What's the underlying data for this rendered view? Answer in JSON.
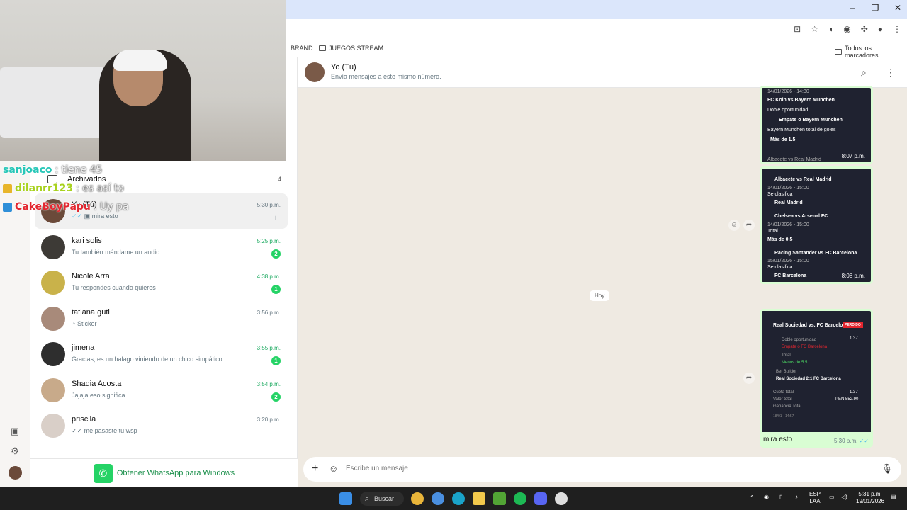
{
  "browser": {
    "bookmarks": [
      "BRAND",
      "JUEGOS STREAM"
    ],
    "all_bookmarks": "Todos los marcadores"
  },
  "chat_list": {
    "archived_label": "Archivados",
    "archived_count": "4",
    "chats": [
      {
        "name": "Yo (Tú)",
        "preview": "mira esto",
        "time": "5:30 p.m.",
        "unread": "",
        "pinned": true
      },
      {
        "name": "kari solis",
        "preview": "Tu también mándame un audio",
        "time": "5:25 p.m.",
        "unread": "2"
      },
      {
        "name": "Nicole Arra",
        "preview": "Tu respondes cuando quieres",
        "time": "4:38 p.m.",
        "unread": "1"
      },
      {
        "name": "tatiana guti",
        "preview": "Sticker",
        "time": "3:56 p.m.",
        "unread": ""
      },
      {
        "name": "jimena",
        "preview": "Gracias, es un halago viniendo de un chico simpático",
        "time": "3:55 p.m.",
        "unread": "1"
      },
      {
        "name": "Shadia Acosta",
        "preview": "Jajaja eso significa",
        "time": "3:54 p.m.",
        "unread": "2"
      },
      {
        "name": "priscila",
        "preview": "me pasaste tu wsp",
        "time": "3:20 p.m.",
        "unread": ""
      }
    ],
    "get_app_label": "Obtener WhatsApp para Windows"
  },
  "conversation": {
    "title": "Yo (Tú)",
    "subtitle": "Envía mensajes a este mismo número.",
    "day_label": "Hoy",
    "bet1": {
      "lines": [
        "14/01/2026 - 14:30",
        "FC Köln  vs  Bayern München",
        "Doble oportunidad",
        "Empate o Bayern München",
        "Bayern München total de goles",
        "Más de 1.5",
        "Albacete  vs  Real Madrid"
      ],
      "time": "8:07 p.m."
    },
    "bet2": {
      "lines": [
        "Albacete  vs  Real Madrid",
        "14/01/2026 - 15:00",
        "Se clasifica",
        "Real Madrid",
        "Chelsea  vs  Arsenal FC",
        "14/01/2026 - 15:00",
        "Total",
        "Más de 0.5",
        "Racing Santander  vs  FC Barcelona",
        "15/01/2026 - 15:00",
        "Se clasifica",
        "FC Barcelona"
      ],
      "time": "8:08 p.m."
    },
    "bet3": {
      "title": "Real Sociedad vs. FC Barcelona",
      "status": "PERDIDO",
      "lines": [
        "Doble oportunidad",
        "Empate o FC Barcelona",
        "Total",
        "Menos de 5.5",
        "Bet Builder",
        "Real Sociedad 2:1 FC Barcelona",
        "Cuota total",
        "Valor total",
        "Ganancia Total",
        "18/01 - 14:57"
      ],
      "odds": "1.37",
      "total_odds": "1.37",
      "total_value": "PEN 552.90"
    },
    "last_message": {
      "text": "mira esto",
      "time": "5:30 p.m."
    },
    "composer_placeholder": "Escribe un mensaje"
  },
  "stream_chat": [
    {
      "user": "sanjoaco",
      "msg": ": tiene 45",
      "color": "#27c7b8"
    },
    {
      "user": "dilanrr123",
      "msg": ": es así to",
      "color": "#a8d21e"
    },
    {
      "user": "CakeBoyPapu",
      "msg": ": Uy pa",
      "color": "#e3262f"
    }
  ],
  "taskbar": {
    "search_label": "Buscar",
    "lang": "ESP",
    "lang2": "LAA",
    "time": "5:31 p.m.",
    "date": "19/01/2026"
  }
}
